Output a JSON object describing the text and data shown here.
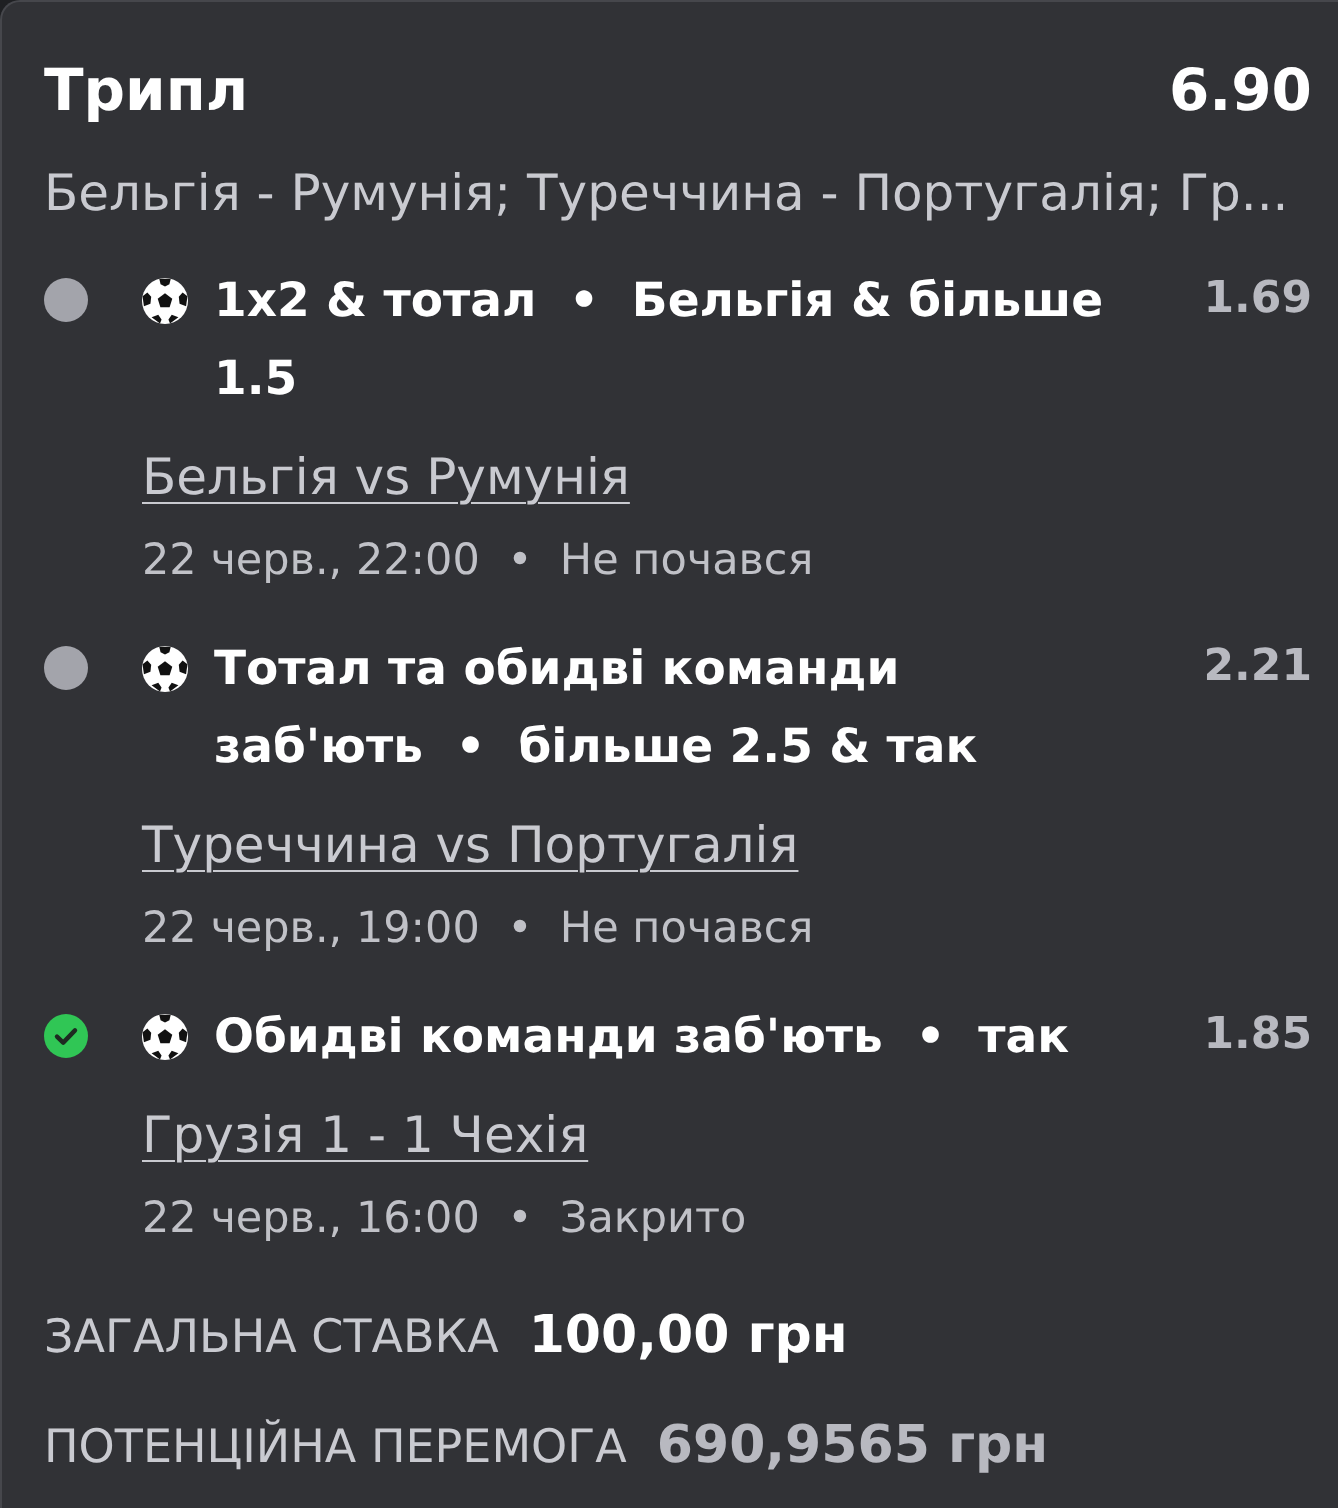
{
  "bet": {
    "type": "Трипл",
    "odds": "6.90",
    "events": "Бельгія - Румунія; Туреччина - Португалія; Гр..."
  },
  "selections": [
    {
      "won": false,
      "title": "1x2 & тотал  •  Бельгія & більше 1.5",
      "odds": "1.69",
      "match": "Бельгія vs Румунія",
      "info": "22 черв., 22:00  •  Не почався"
    },
    {
      "won": false,
      "title": "Тотал та обидві команди заб'ють  •  більше 2.5 & так",
      "odds": "2.21",
      "match": "Туреччина vs Португалія",
      "info": "22 черв., 19:00  •  Не почався"
    },
    {
      "won": true,
      "title": "Обидві команди заб'ють  •  так",
      "odds": "1.85",
      "match": "Грузія 1 - 1 Чехія",
      "info": "22 черв., 16:00  •  Закрито"
    }
  ],
  "totals": [
    {
      "kind": "stake",
      "label": "ЗАГАЛЬНА СТАВКА",
      "value": "100,00 грн"
    },
    {
      "kind": "potential",
      "label": "ПОТЕНЦІЙНА ПЕРЕМОГА",
      "value": "690,9565 грн"
    }
  ]
}
